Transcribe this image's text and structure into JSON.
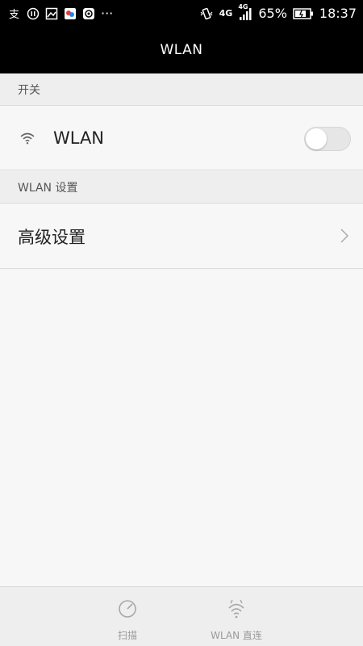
{
  "status_bar": {
    "left_icons": [
      "alipay-icon",
      "notification-icon",
      "gallery-icon",
      "app-icon",
      "browser-icon",
      "more-icon"
    ],
    "more_glyph": "···",
    "network_4g": "4G",
    "network_4g_small": "4G",
    "battery_percent": "65%",
    "time": "18:37"
  },
  "header": {
    "title": "WLAN"
  },
  "sections": {
    "switch": {
      "header": "开关",
      "wlan_label": "WLAN",
      "wlan_enabled": false
    },
    "settings": {
      "header": "WLAN 设置",
      "advanced_label": "高级设置"
    }
  },
  "bottom_bar": {
    "scan_label": "扫描",
    "direct_label": "WLAN 直连"
  }
}
